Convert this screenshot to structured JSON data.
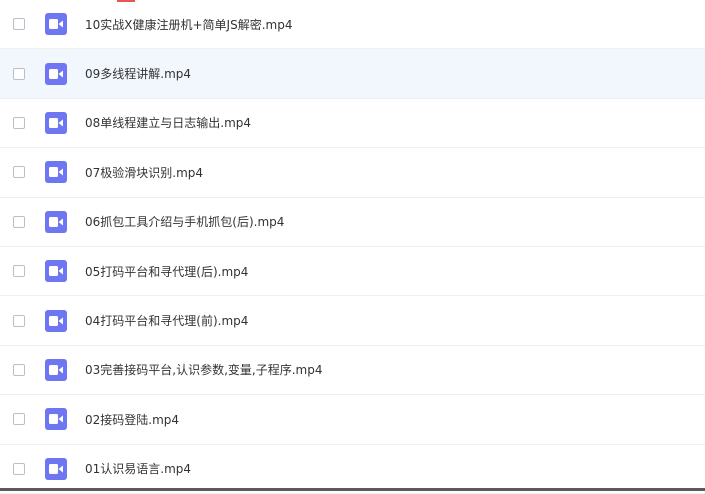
{
  "files": [
    {
      "name": "10实战X健康注册机+简单JS解密.mp4",
      "icon": "video-file-icon"
    },
    {
      "name": "09多线程讲解.mp4",
      "icon": "video-file-icon"
    },
    {
      "name": "08单线程建立与日志输出.mp4",
      "icon": "video-file-icon"
    },
    {
      "name": "07极验滑块识别.mp4",
      "icon": "video-file-icon"
    },
    {
      "name": "06抓包工具介绍与手机抓包(后).mp4",
      "icon": "video-file-icon"
    },
    {
      "name": "05打码平台和寻代理(后).mp4",
      "icon": "video-file-icon"
    },
    {
      "name": "04打码平台和寻代理(前).mp4",
      "icon": "video-file-icon"
    },
    {
      "name": "03完善接码平台,认识参数,变量,子程序.mp4",
      "icon": "video-file-icon"
    },
    {
      "name": "02接码登陆.mp4",
      "icon": "video-file-icon"
    },
    {
      "name": "01认识易语言.mp4",
      "icon": "video-file-icon"
    }
  ],
  "colors": {
    "icon_bg": "#6f76f2",
    "hover_row_bg": "#f2f7fe",
    "text": "#333333"
  }
}
